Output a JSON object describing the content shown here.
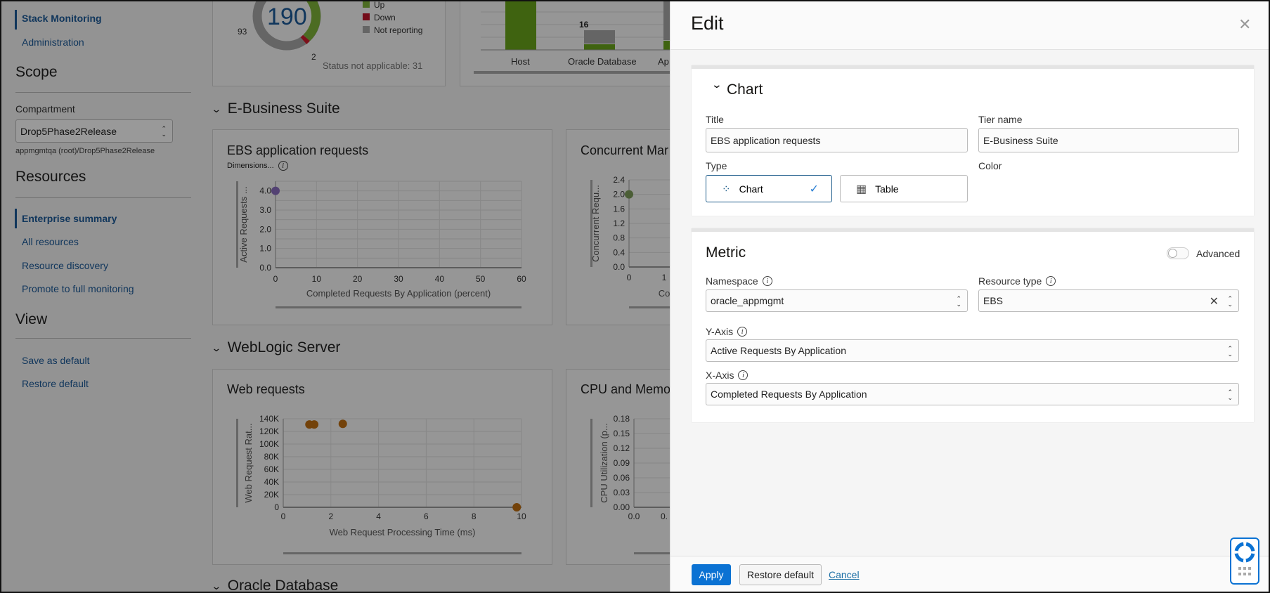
{
  "sidebar": {
    "nav": [
      {
        "label": "Stack Monitoring",
        "active": true
      },
      {
        "label": "Administration",
        "active": false
      }
    ],
    "scope_heading": "Scope",
    "compartment_label": "Compartment",
    "compartment_value": "Drop5Phase2Release",
    "compartment_path": "appmgmtqa (root)/Drop5Phase2Release",
    "resources_heading": "Resources",
    "resources": [
      {
        "label": "Enterprise summary",
        "active": true
      },
      {
        "label": "All resources"
      },
      {
        "label": "Resource discovery"
      },
      {
        "label": "Promote to full monitoring"
      }
    ],
    "view_heading": "View",
    "view_links": [
      {
        "label": "Save as default"
      },
      {
        "label": "Restore default"
      }
    ]
  },
  "main": {
    "status_donut": {
      "total": "190",
      "not_reporting": "93",
      "down": "2",
      "legend": [
        "Up",
        "Down",
        "Not reporting"
      ],
      "legend_colors": [
        "#4a7a10",
        "#b0111e",
        "#6b6b6b"
      ],
      "status_na": "Status not applicable: 31"
    },
    "bar_chart": {
      "categories": [
        "Host",
        "Oracle Database",
        "Ap"
      ],
      "data_label": "16"
    },
    "sections": [
      "E-Business Suite",
      "WebLogic Server",
      "Oracle Database"
    ],
    "dimensions_label": "Dimensions..."
  },
  "chart_data": [
    {
      "type": "scatter",
      "title": "EBS application requests",
      "xlabel": "Completed Requests By Application (percent)",
      "ylabel": "Active Requests ...",
      "xlim": [
        0,
        60
      ],
      "ylim": [
        0,
        4.5
      ],
      "xticks": [
        "0",
        "10",
        "20",
        "30",
        "40",
        "50",
        "60"
      ],
      "yticks": [
        "0.0",
        "1.0",
        "2.0",
        "3.0",
        "4.0"
      ],
      "points": [
        [
          0,
          4.0
        ]
      ],
      "color": "#8a6fc0"
    },
    {
      "type": "scatter",
      "title": "Concurrent Mar",
      "xlabel": "Co",
      "ylabel": "Concurrent Requ...",
      "xlim": [
        0,
        10
      ],
      "ylim": [
        0,
        2.4
      ],
      "xticks": [
        "0",
        "1"
      ],
      "yticks": [
        "0.0",
        "0.4",
        "0.8",
        "1.2",
        "1.6",
        "2.0",
        "2.4"
      ],
      "points": [
        [
          0,
          2.0
        ]
      ],
      "color": "#7d9d5a"
    },
    {
      "type": "scatter",
      "title": "Web requests",
      "xlabel": "Web Request Processing Time (ms)",
      "ylabel": "Web Request Rat...",
      "xlim": [
        0,
        10
      ],
      "ylim": [
        0,
        140000
      ],
      "xticks": [
        "0",
        "2",
        "4",
        "6",
        "8",
        "10"
      ],
      "yticks": [
        "0",
        "20K",
        "40K",
        "60K",
        "80K",
        "100K",
        "120K",
        "140K"
      ],
      "points": [
        [
          1.1,
          131000
        ],
        [
          1.3,
          131000
        ],
        [
          2.5,
          132000
        ],
        [
          9.8,
          0
        ]
      ],
      "color": "#c06f12"
    },
    {
      "type": "scatter",
      "title": "CPU and Memo",
      "xlabel": "",
      "ylabel": "CPU Utilization (p...",
      "xlim": [
        0,
        0.2
      ],
      "ylim": [
        0,
        0.18
      ],
      "xticks": [
        "0.0",
        "0."
      ],
      "yticks": [
        "0.00",
        "0.03",
        "0.06",
        "0.09",
        "0.12",
        "0.15",
        "0.18"
      ],
      "points": [],
      "color": "#888888"
    }
  ],
  "panel": {
    "title": "Edit",
    "chart_section": {
      "heading": "Chart",
      "title_label": "Title",
      "title_value": "EBS application requests",
      "tier_label": "Tier name",
      "tier_value": "E-Business Suite",
      "type_label": "Type",
      "type_options": [
        "Chart",
        "Table"
      ],
      "type_selected": "Chart",
      "color_label": "Color",
      "colors": [
        "#a2c98a",
        "#5fb8b4",
        "#5f9fba",
        "#9f7fc8",
        "#b57180",
        "#dd7f14",
        "#f9c26a"
      ],
      "color_selected": "#9f7fc8"
    },
    "metric_section": {
      "heading": "Metric",
      "advanced_label": "Advanced",
      "advanced_on": false,
      "namespace_label": "Namespace",
      "namespace_value": "oracle_appmgmt",
      "resource_type_label": "Resource type",
      "resource_type_value": "EBS",
      "y_axis_label": "Y-Axis",
      "y_axis_value": "Active Requests By Application",
      "x_axis_label": "X-Axis",
      "x_axis_value": "Completed Requests By Application"
    },
    "footer": {
      "apply": "Apply",
      "restore": "Restore default",
      "cancel": "Cancel"
    },
    "accent": "#0b72d3"
  }
}
